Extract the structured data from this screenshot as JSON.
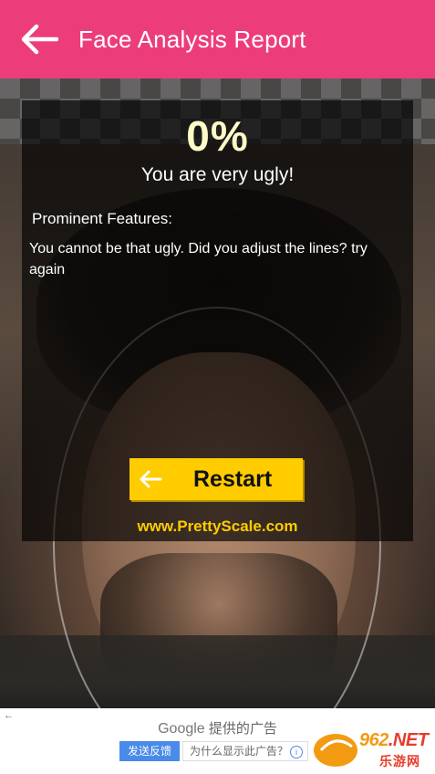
{
  "app_bar": {
    "title": "Face Analysis Report",
    "back_icon": "arrow-left-icon",
    "background": "#ec3d7a"
  },
  "result": {
    "score": "0%",
    "verdict": "You are very ugly!",
    "features_heading": "Prominent Features:",
    "features_text": "You cannot be that ugly. Did you adjust the lines? try again",
    "restart_label": "Restart",
    "restart_icon": "arrow-left-icon",
    "website": "www.PrettyScale.com",
    "score_color": "#fffbc7",
    "button_color": "#ffcc00"
  },
  "ad": {
    "brand": "Google",
    "provided_by": "提供的广告",
    "feedback_label": "发送反馈",
    "why_label": "为什么显示此广告？",
    "info_icon": "i"
  },
  "watermark": {
    "domain_num": "962",
    "domain_rest": ".NET",
    "cn_text": "乐游网"
  }
}
